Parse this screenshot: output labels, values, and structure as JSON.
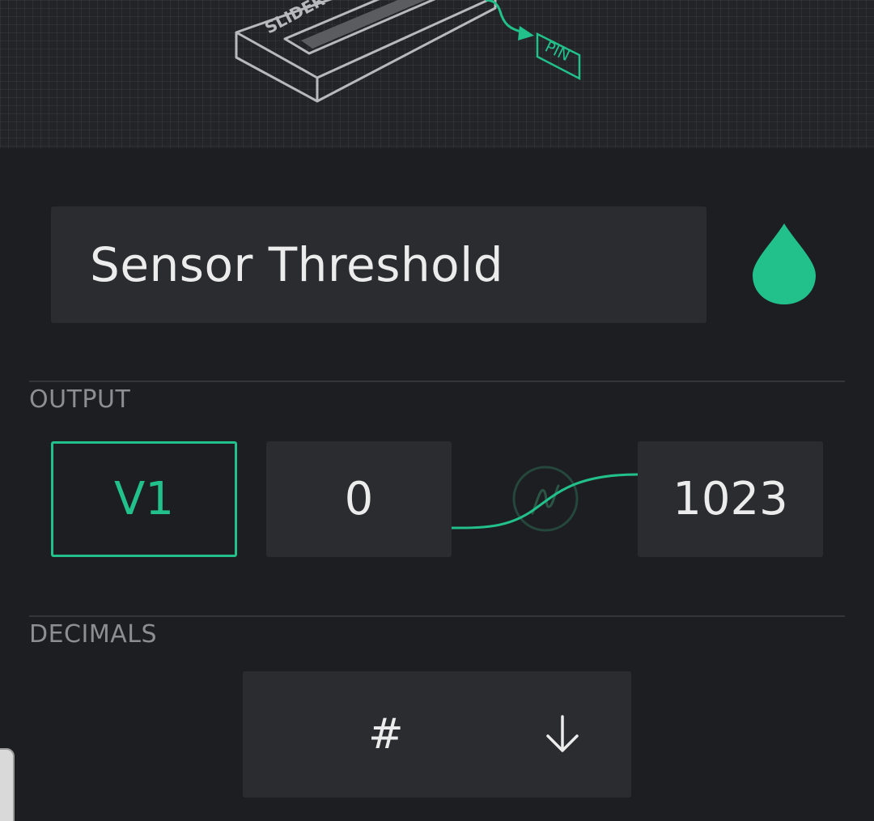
{
  "header": {
    "slider_label": "SLIDER",
    "pin_label": "PIN"
  },
  "widget": {
    "name": "Sensor Threshold",
    "accent_color": "#22c08a"
  },
  "output": {
    "section_label": "OUTPUT",
    "pin": "V1",
    "min_value": "0",
    "max_value": "1023"
  },
  "decimals": {
    "section_label": "DECIMALS",
    "value": "#"
  },
  "icons": {
    "color": "water-drop-icon",
    "mapping": "wave-curve-icon",
    "dropdown": "arrow-down-icon"
  }
}
